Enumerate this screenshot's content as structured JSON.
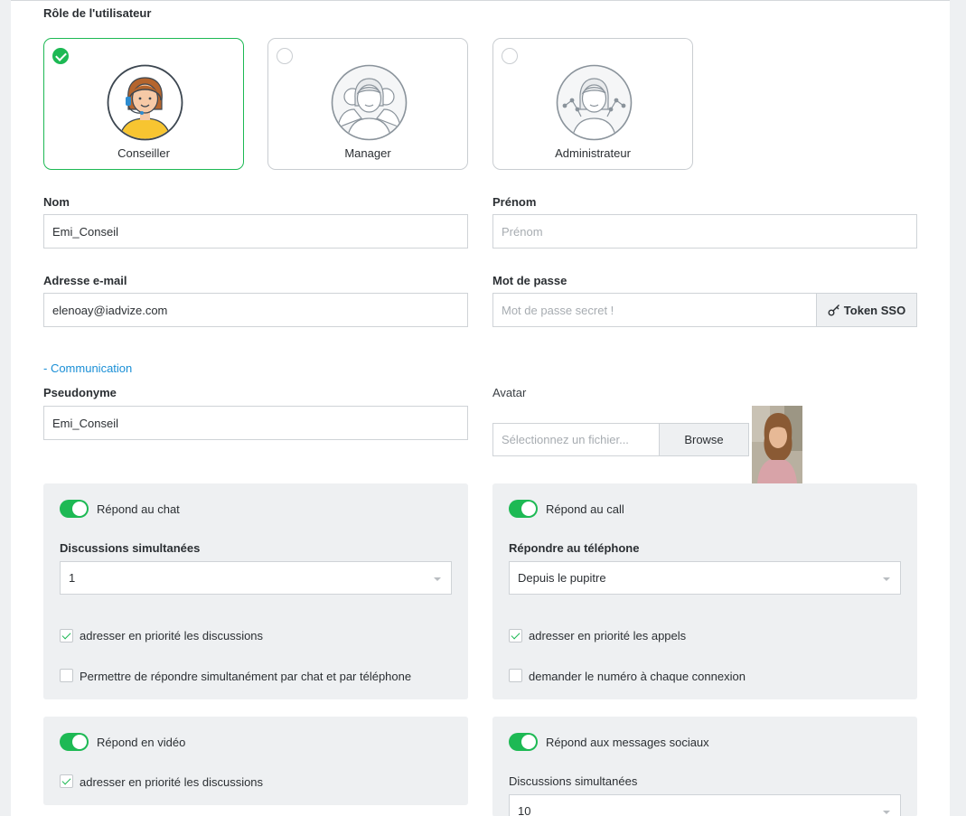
{
  "role_section": {
    "title": "Rôle de l'utilisateur",
    "roles": [
      {
        "label": "Conseiller",
        "selected": true
      },
      {
        "label": "Manager",
        "selected": false
      },
      {
        "label": "Administrateur",
        "selected": false
      }
    ]
  },
  "fields": {
    "nom_label": "Nom",
    "nom_value": "Emi_Conseil",
    "prenom_label": "Prénom",
    "prenom_placeholder": "Prénom",
    "email_label": "Adresse e-mail",
    "email_value": "elenoay@iadvize.com",
    "password_label": "Mot de passe",
    "password_placeholder": "Mot de passe secret !",
    "token_button": "Token SSO"
  },
  "communication": {
    "link": "- Communication",
    "pseudo_label": "Pseudonyme",
    "pseudo_value": "Emi_Conseil",
    "avatar_label": "Avatar",
    "file_placeholder": "Sélectionnez un fichier...",
    "browse_button": "Browse"
  },
  "chat_panel": {
    "toggle_label": "Répond au chat",
    "toggle_on": true,
    "select_label": "Discussions simultanées",
    "select_value": "1",
    "check1_label": "adresser en priorité les discussions",
    "check1_on": true,
    "check2_label": "Permettre de répondre simultanément par chat et par téléphone",
    "check2_on": false
  },
  "call_panel": {
    "toggle_label": "Répond au call",
    "toggle_on": true,
    "select_label": "Répondre au téléphone",
    "select_value": "Depuis le pupitre",
    "check1_label": "adresser en priorité les appels",
    "check1_on": true,
    "check2_label": "demander le numéro à chaque connexion",
    "check2_on": false
  },
  "video_panel": {
    "toggle_label": "Répond en vidéo",
    "toggle_on": true,
    "check1_label": "adresser en priorité les discussions",
    "check1_on": true
  },
  "social_panel": {
    "toggle_label": "Répond aux messages sociaux",
    "toggle_on": true,
    "select_label": "Discussions simultanées",
    "select_value": "10"
  },
  "colors": {
    "accent_green": "#1db954",
    "link_blue": "#1a8fd6",
    "panel_bg": "#eef0f2"
  }
}
